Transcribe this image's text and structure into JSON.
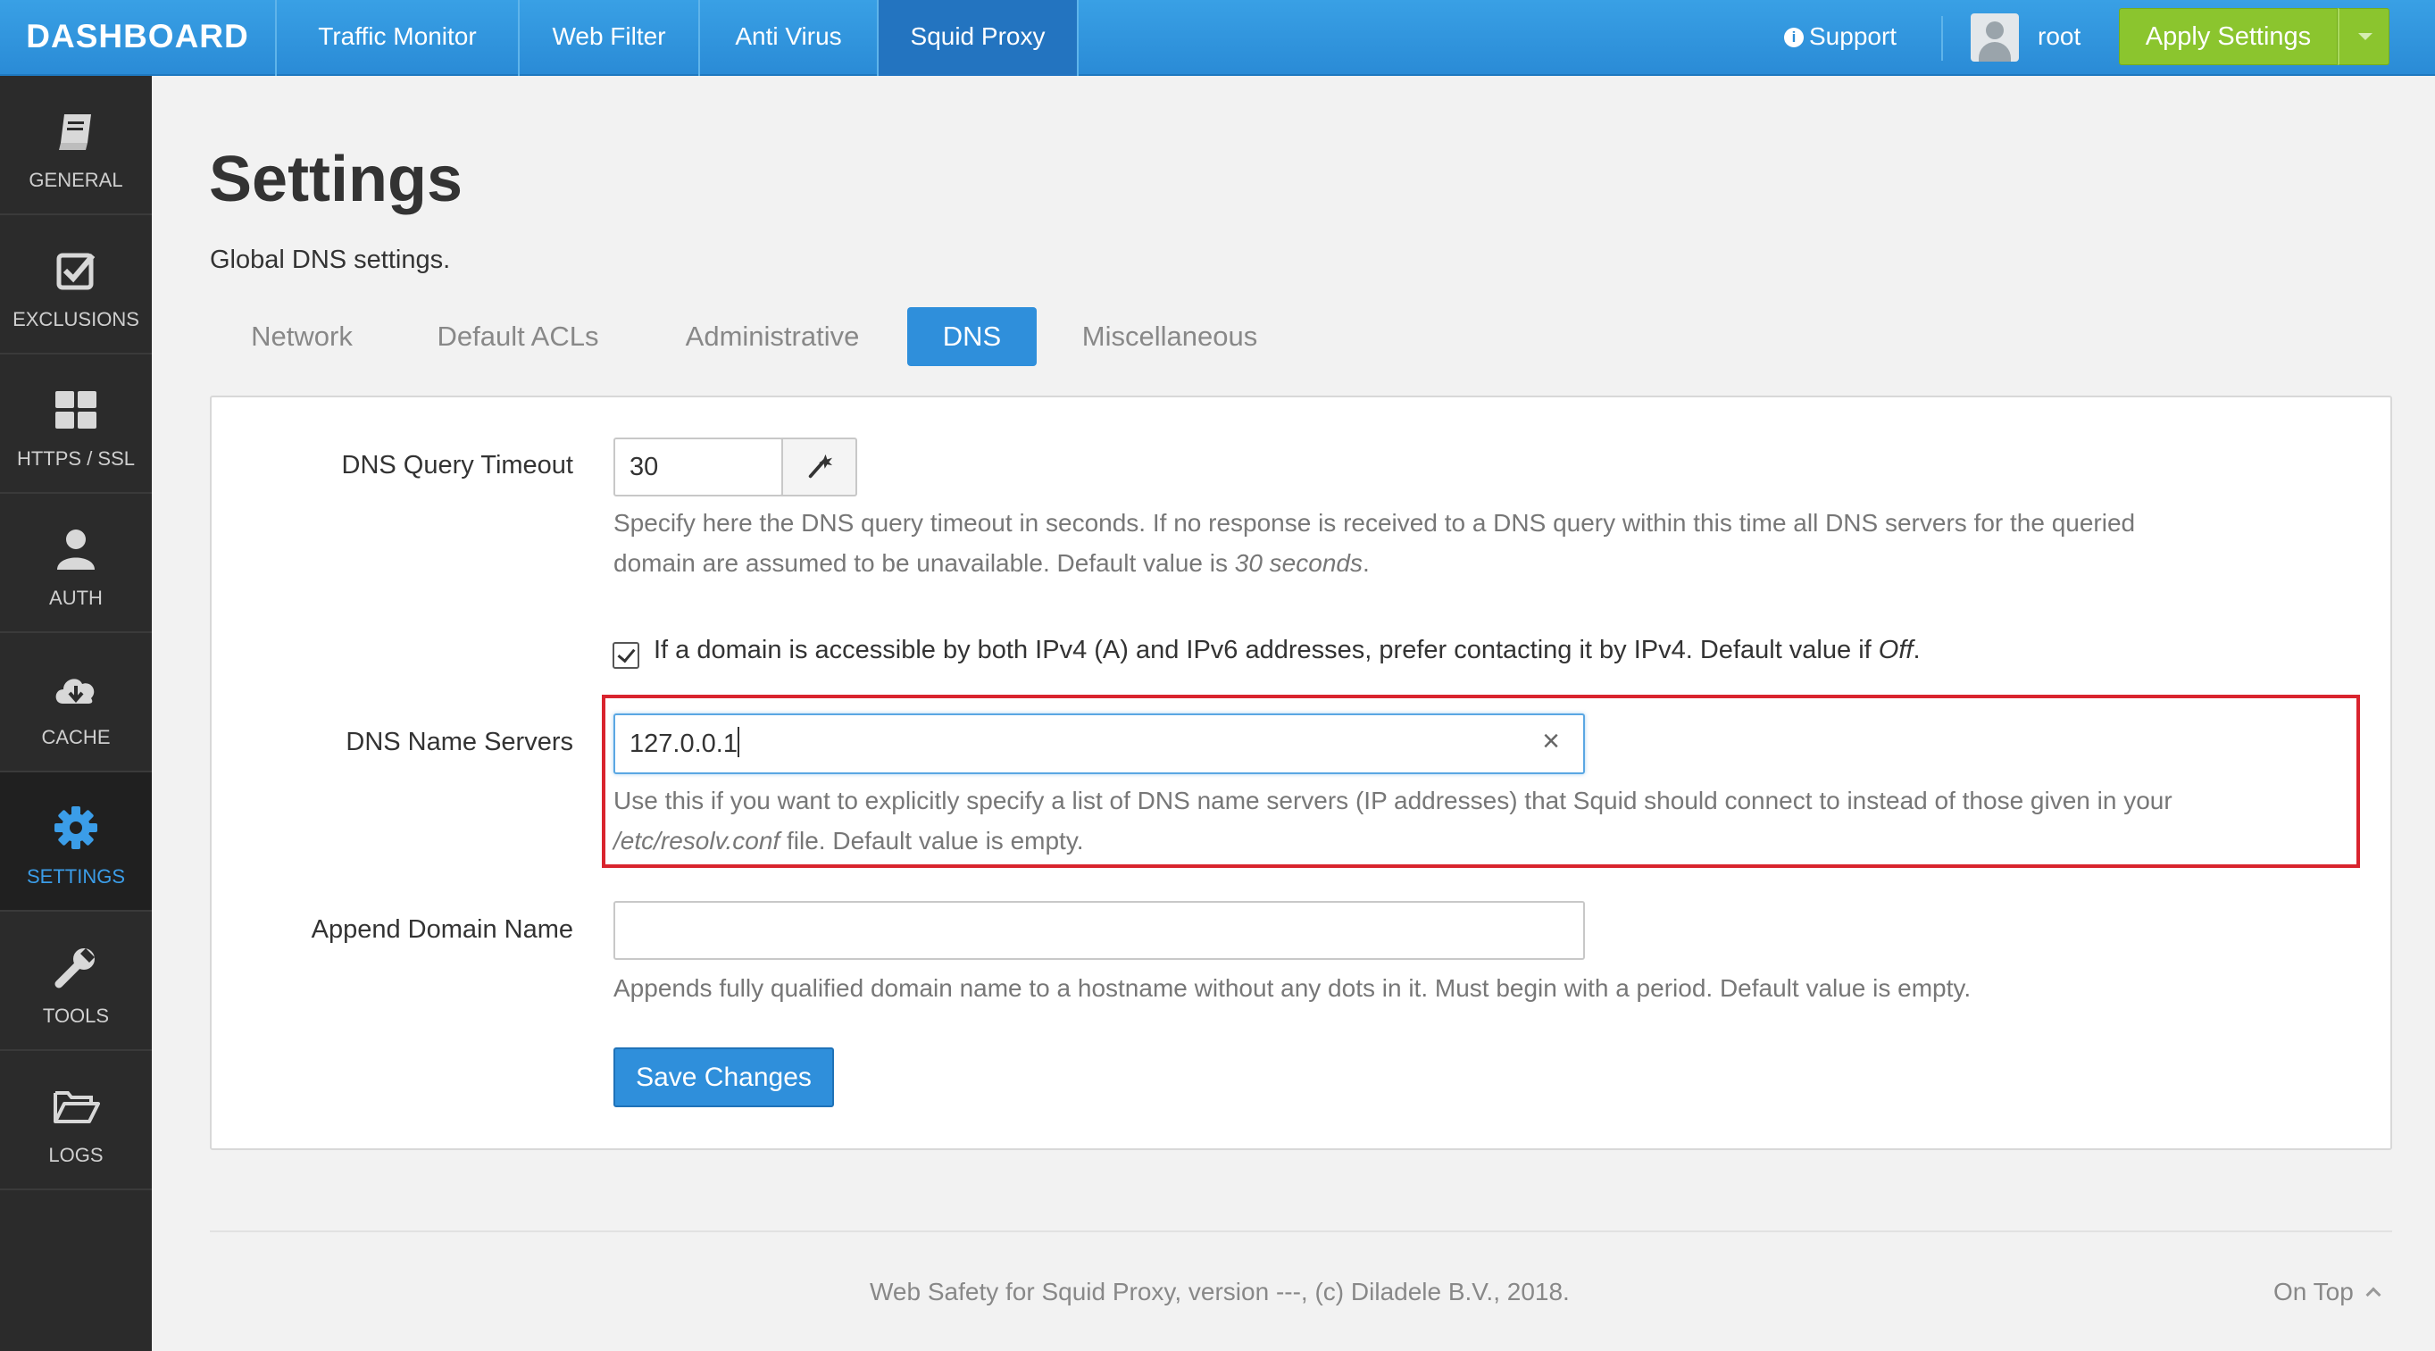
{
  "topbar": {
    "brand": "DASHBOARD",
    "nav": [
      "Traffic Monitor",
      "Web Filter",
      "Anti Virus",
      "Squid Proxy"
    ],
    "active_nav": "Squid Proxy",
    "support": "Support",
    "user": "root",
    "apply": "Apply Settings"
  },
  "sidebar": {
    "items": [
      {
        "label": "GENERAL",
        "icon": "book-icon"
      },
      {
        "label": "EXCLUSIONS",
        "icon": "check-square-icon"
      },
      {
        "label": "HTTPS / SSL",
        "icon": "grid-icon"
      },
      {
        "label": "AUTH",
        "icon": "user-icon"
      },
      {
        "label": "CACHE",
        "icon": "cloud-download-icon"
      },
      {
        "label": "SETTINGS",
        "icon": "gear-icon"
      },
      {
        "label": "TOOLS",
        "icon": "wrench-icon"
      },
      {
        "label": "LOGS",
        "icon": "folder-open-icon"
      }
    ],
    "active": "SETTINGS"
  },
  "page": {
    "title": "Settings",
    "subtitle": "Global DNS settings.",
    "tabs": [
      "Network",
      "Default ACLs",
      "Administrative",
      "DNS",
      "Miscellaneous"
    ],
    "active_tab": "DNS"
  },
  "form": {
    "timeout": {
      "label": "DNS Query Timeout",
      "value": "30",
      "help_1": "Specify here the DNS query timeout in seconds. If no response is received to a DNS query within this time all DNS servers for the queried",
      "help_2a": "domain are assumed to be unavailable. Default value is ",
      "help_2b": "30 seconds",
      "help_2c": "."
    },
    "prefer_ipv4": {
      "checked": true,
      "text_a": "If a domain is accessible by both IPv4 (A) and IPv6 addresses, prefer contacting it by IPv4. Default value if ",
      "text_b": "Off",
      "text_c": "."
    },
    "name_servers": {
      "label": "DNS Name Servers",
      "value": "127.0.0.1",
      "help_1": "Use this if you want to explicitly specify a list of DNS name servers (IP addresses) that Squid should connect to instead of those given in your",
      "help_2a": "/etc/resolv.conf",
      "help_2b": " file. Default value is empty."
    },
    "append_domain": {
      "label": "Append Domain Name",
      "value": "",
      "help": "Appends fully qualified domain name to a hostname without any dots in it. Must begin with a period. Default value is empty."
    },
    "save": "Save Changes"
  },
  "footer": {
    "text": "Web Safety for Squid Proxy, version ---, (c) Diladele B.V., 2018.",
    "on_top": "On Top"
  },
  "colors": {
    "accent": "#2f8fdb",
    "apply": "#8bc52e",
    "highlight": "#d9242e",
    "sidebar": "#2b2b2b"
  }
}
